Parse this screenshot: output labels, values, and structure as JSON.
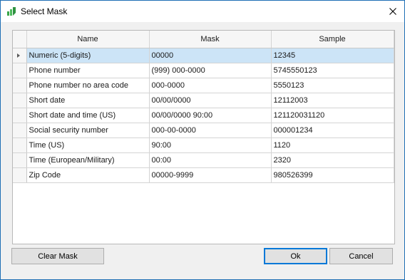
{
  "window": {
    "title": "Select Mask"
  },
  "icons": {
    "app": "app-logo-icon",
    "close": "close-icon",
    "row_indicator": "row-pointer-icon"
  },
  "colors": {
    "accent": "#0078d7",
    "selection": "#cce4f7",
    "border": "#1f6fb5"
  },
  "grid": {
    "columns": [
      "Name",
      "Mask",
      "Sample"
    ],
    "rows": [
      {
        "name": "Numeric (5-digits)",
        "mask": "00000",
        "sample": "12345",
        "selected": true
      },
      {
        "name": "Phone number",
        "mask": "(999) 000-0000",
        "sample": "5745550123"
      },
      {
        "name": "Phone number no area code",
        "mask": "000-0000",
        "sample": "5550123"
      },
      {
        "name": "Short date",
        "mask": "00/00/0000",
        "sample": "12112003"
      },
      {
        "name": "Short date and time (US)",
        "mask": "00/00/0000 90:00",
        "sample": "121120031120"
      },
      {
        "name": "Social security number",
        "mask": "000-00-0000",
        "sample": "000001234"
      },
      {
        "name": "Time (US)",
        "mask": "90:00",
        "sample": "1120"
      },
      {
        "name": "Time (European/Military)",
        "mask": "00:00",
        "sample": "2320"
      },
      {
        "name": "Zip Code",
        "mask": "00000-9999",
        "sample": "980526399"
      }
    ]
  },
  "buttons": {
    "clear_mask": "Clear Mask",
    "ok": "Ok",
    "cancel": "Cancel"
  }
}
